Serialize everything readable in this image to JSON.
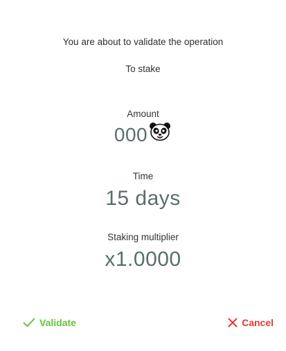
{
  "dialog": {
    "intro_line_1": "You are about to validate the operation",
    "intro_line_2": "To stake"
  },
  "amount": {
    "label": "Amount",
    "value": "000",
    "icon": "panda-token-icon"
  },
  "time": {
    "label": "Time",
    "value": "15 days"
  },
  "multiplier": {
    "label": "Staking multiplier",
    "value": "x1.0000"
  },
  "actions": {
    "validate_label": "Validate",
    "validate_icon": "check-icon",
    "cancel_label": "Cancel",
    "cancel_icon": "close-icon",
    "validate_color": "#64c33c",
    "cancel_color": "#e53935"
  }
}
